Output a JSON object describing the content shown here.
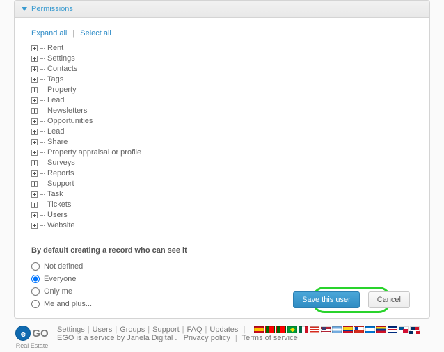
{
  "panel": {
    "title": "Permissions",
    "expand_all": "Expand all",
    "select_all": "Select all"
  },
  "tree": [
    {
      "label": "Rent"
    },
    {
      "label": "Settings"
    },
    {
      "label": "Contacts"
    },
    {
      "label": "Tags"
    },
    {
      "label": "Property"
    },
    {
      "label": "Lead"
    },
    {
      "label": "Newsletters"
    },
    {
      "label": "Opportunities"
    },
    {
      "label": "Lead"
    },
    {
      "label": "Share"
    },
    {
      "label": "Property appraisal or profile"
    },
    {
      "label": "Surveys"
    },
    {
      "label": "Reports"
    },
    {
      "label": "Support"
    },
    {
      "label": "Task"
    },
    {
      "label": "Tickets"
    },
    {
      "label": "Users"
    },
    {
      "label": "Website"
    }
  ],
  "visibility": {
    "section_label": "By default creating a record who can see it",
    "options": [
      {
        "label": "Not defined",
        "checked": false
      },
      {
        "label": "Everyone",
        "checked": true
      },
      {
        "label": "Only me",
        "checked": false
      },
      {
        "label": "Me and plus...",
        "checked": false
      }
    ]
  },
  "actions": {
    "save": "Save this user",
    "cancel": "Cancel"
  },
  "footer": {
    "logo_sub": "Real Estate",
    "links": [
      "Settings",
      "Users",
      "Groups",
      "Support",
      "FAQ",
      "Updates"
    ],
    "tagline_pre": "EGO is a service by ",
    "tagline_link": "Janela Digital",
    "privacy": "Privacy policy",
    "terms": "Terms of service"
  }
}
